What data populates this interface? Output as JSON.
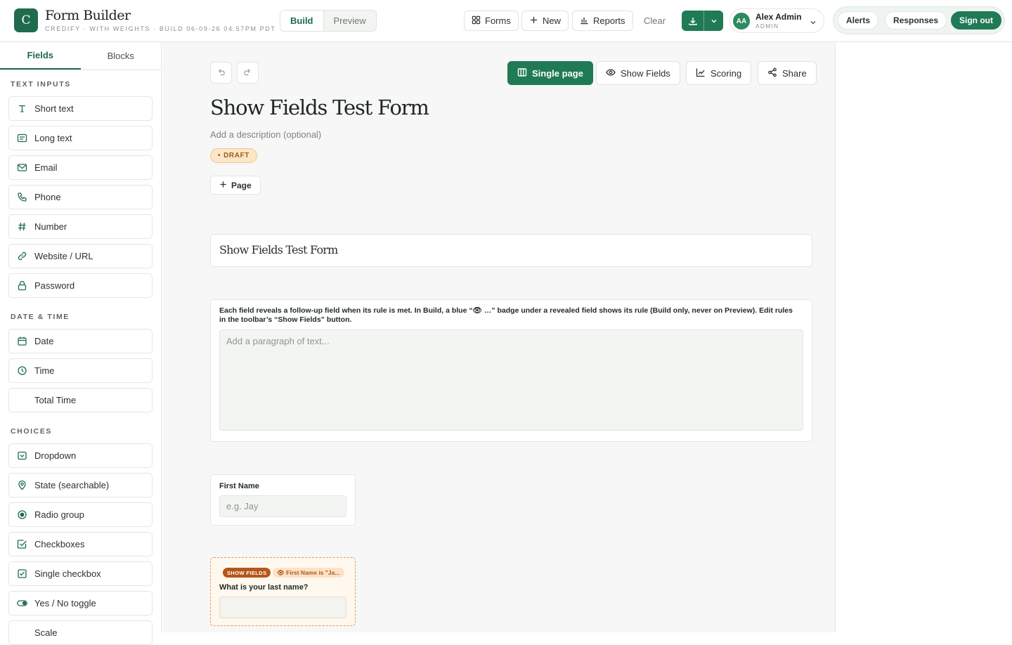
{
  "app": {
    "logo_letter": "C",
    "title": "Form Builder",
    "subtitle": "CREDIFY · WITH WEIGHTS · BUILD 06-09-26 04:57PM PDT",
    "accent": "#1f7a55"
  },
  "mode_switch": {
    "build": "Build",
    "preview": "Preview",
    "selected": "Build"
  },
  "toolbar": {
    "forms": "Forms",
    "new": "New",
    "reports": "Reports",
    "clear": "Clear",
    "download_icon": "download-icon"
  },
  "user": {
    "initials": "AA",
    "name": "Alex Admin",
    "role": "ADMIN"
  },
  "top_right": {
    "alerts": "Alerts",
    "responses": "Responses",
    "sign_out": "Sign out"
  },
  "sidebar": {
    "tabs": [
      "Fields",
      "Blocks"
    ],
    "active_tab": "Fields",
    "sections": [
      {
        "title": "TEXT INPUTS",
        "items": [
          "Short text",
          "Long text",
          "Email",
          "Phone",
          "Number",
          "Website / URL",
          "Password"
        ]
      },
      {
        "title": "DATE & TIME",
        "items": [
          "Date",
          "Time",
          "Total Time"
        ]
      },
      {
        "title": "CHOICES",
        "items": [
          "Dropdown",
          "State (searchable)",
          "Radio group",
          "Checkboxes",
          "Single checkbox",
          "Yes / No toggle",
          "Scale"
        ]
      }
    ]
  },
  "canvas": {
    "buttons": {
      "single_page": "Single page",
      "show_fields": "Show Fields",
      "scoring": "Scoring",
      "share": "Share"
    },
    "form_title": "Show Fields Test Form",
    "description_placeholder": "Add a description (optional)",
    "status": "DRAFT",
    "page_button": "Page",
    "heading_block": "Show Fields Test Form",
    "paragraph_block": {
      "text": "Each field reveals a follow-up field when its rule is met. In Build, a blue “👁 …” badge under a revealed field shows its rule (Build only, never on Preview). Edit rules in the toolbar’s “Show Fields” button.",
      "placeholder": "Add a paragraph of text..."
    },
    "first_name": {
      "label": "First Name",
      "placeholder": "e.g. Jay"
    },
    "last_name": {
      "badge": "SHOW FIELDS",
      "rule": "👁 First Name is \"Ja...",
      "label": "What is your last name?"
    }
  }
}
